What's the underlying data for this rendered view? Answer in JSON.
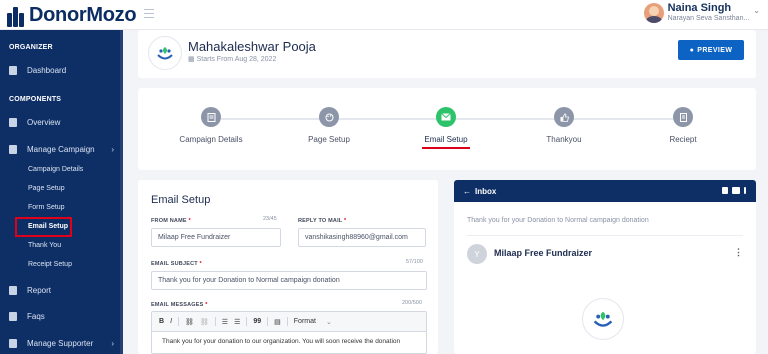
{
  "brand": {
    "name": "DonorMozo"
  },
  "user": {
    "name": "Naina Singh",
    "org": "Narayan Seva Sansthan..."
  },
  "sidebar": {
    "sections": {
      "organizer": "ORGANIZER",
      "components": "COMPONENTS"
    },
    "items": {
      "dashboard": "Dashboard",
      "overview": "Overview",
      "manage_campaign": "Manage Campaign",
      "report": "Report",
      "faqs": "Faqs",
      "manage_supporter": "Manage Supporter"
    },
    "sub_items": [
      {
        "label": "Campaign Details"
      },
      {
        "label": "Page Setup"
      },
      {
        "label": "Form Setup"
      },
      {
        "label": "Email Setup",
        "active": true
      },
      {
        "label": "Thank You"
      },
      {
        "label": "Receipt Setup"
      }
    ]
  },
  "header": {
    "title": "Mahakaleshwar Pooja",
    "subtitle": "Starts From Aug 28, 2022",
    "preview_label": "PREVIEW"
  },
  "steps": [
    {
      "label": "Campaign Details",
      "icon": "document-icon"
    },
    {
      "label": "Page Setup",
      "icon": "palette-icon"
    },
    {
      "label": "Email Setup",
      "icon": "envelope-icon",
      "active": true
    },
    {
      "label": "Thankyou",
      "icon": "thumbs-up-icon"
    },
    {
      "label": "Reciept",
      "icon": "receipt-icon"
    }
  ],
  "email_setup": {
    "title": "Email Setup",
    "from_name_label": "FROM NAME",
    "from_name_count": "23/45",
    "from_name_value": "Milaap Free Fundraizer",
    "reply_to_label": "REPLY TO MAIL",
    "reply_to_value": "vanshikasingh88960@gmail.com",
    "subject_label": "EMAIL SUBJECT",
    "subject_count": "57/100",
    "subject_value": "Thank you for your Donation to  Normal campaign donation",
    "messages_label": "EMAIL MESSAGES",
    "messages_count": "200/500",
    "toolbar": {
      "bold": "B",
      "italic": "I",
      "format": "Format",
      "quote": "99"
    },
    "message_body": "Thank you for your donation to our organization. You will soon receive the donation"
  },
  "inbox": {
    "title": "Inbox",
    "back_arrow": "←",
    "subject": "Thank you for your Donation to Normal campaign donation",
    "sender_initial": "Y",
    "sender_name": "Milaap Free Fundraizer"
  },
  "colors": {
    "navy": "#0d2f66",
    "primary": "#0d63c4",
    "success": "#2ec26a",
    "highlight": "#e1001a"
  }
}
